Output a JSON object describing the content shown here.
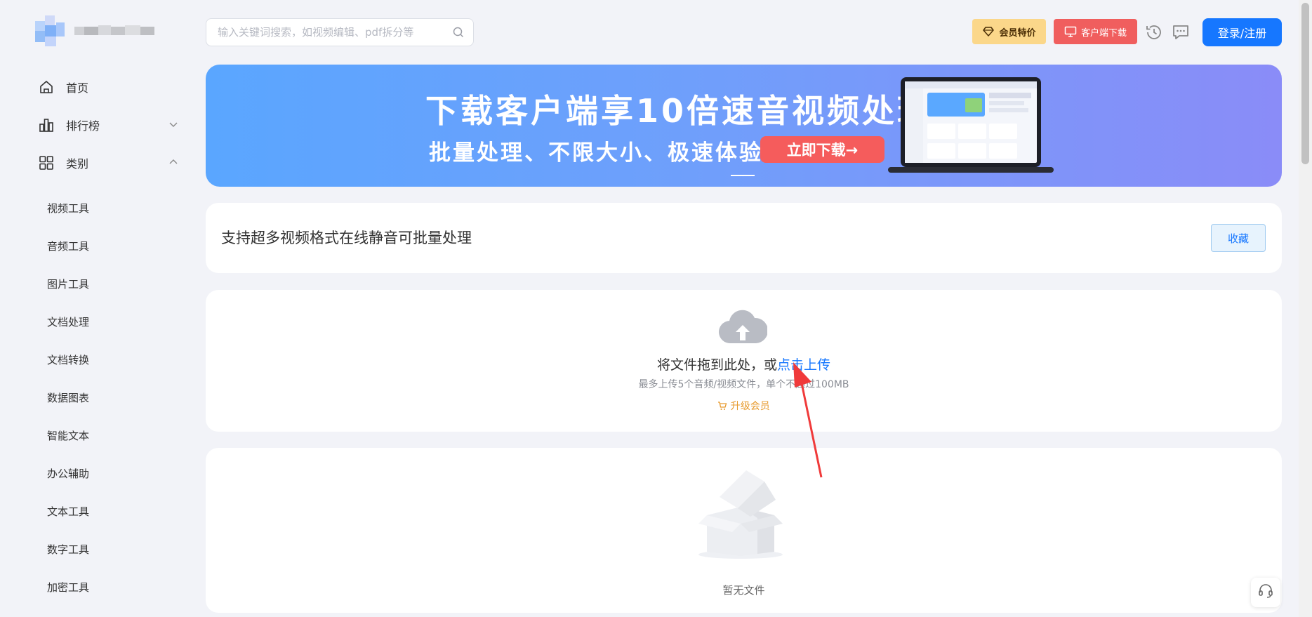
{
  "sidebar": {
    "nav": [
      {
        "label": "首页",
        "icon": "home-icon"
      },
      {
        "label": "排行榜",
        "icon": "bar-chart-icon",
        "expanded": false
      },
      {
        "label": "类别",
        "icon": "grid-icon",
        "expanded": true
      }
    ],
    "categories": [
      "视频工具",
      "音频工具",
      "图片工具",
      "文档处理",
      "文档转换",
      "数据图表",
      "智能文本",
      "办公辅助",
      "文本工具",
      "数字工具",
      "加密工具"
    ]
  },
  "header": {
    "search_placeholder": "输入关键词搜索，如视频编辑、pdf拆分等",
    "vip_label": "会员特价",
    "client_label": "客户端下载",
    "login_label": "登录/注册"
  },
  "banner": {
    "title": "下载客户端享10倍速音视频处理",
    "subtitle": "批量处理、不限大小、极速体验",
    "cta": "立即下载→"
  },
  "tool": {
    "title": "支持超多视频格式在线静音可批量处理",
    "favorite_label": "收藏"
  },
  "upload": {
    "text_prefix": "将文件拖到此处，或",
    "link": "点击上传",
    "hint": "最多上传5个音频/视频文件，单个不超过100MB",
    "upgrade": "升级会员"
  },
  "files": {
    "empty_text": "暂无文件"
  },
  "colors": {
    "primary": "#1677ff",
    "vip": "#fbd78a",
    "client": "#f05e5e",
    "upgrade": "#e79a2d",
    "annotation": "#f03a3a"
  }
}
